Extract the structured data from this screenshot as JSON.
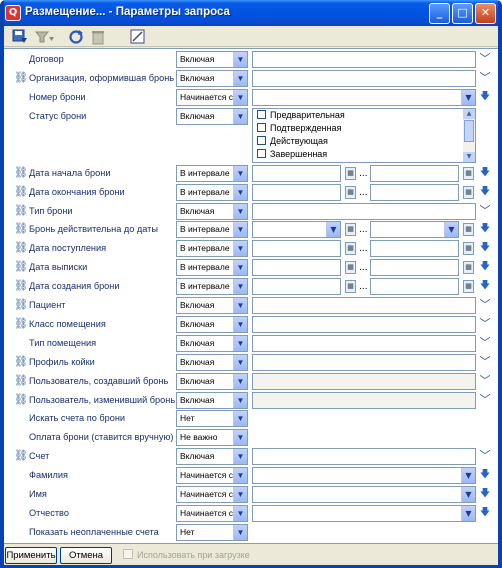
{
  "window": {
    "title": "Размещение... - Параметры запроса",
    "icon": "app-icon",
    "minimize": "_",
    "maximize": "□",
    "close": "✕"
  },
  "toolbar": {
    "icons": [
      "save-filter-icon",
      "clear-filter-icon",
      "refresh-icon",
      "delete-icon",
      "layout-icon"
    ]
  },
  "glyphs": {
    "dropdown": "▼",
    "chevron": "﹀",
    "arrow_down": "🡇",
    "link": "⛓",
    "calendar": "▦",
    "ellipsis": "..."
  },
  "rows": [
    {
      "label": "Договор",
      "op": "Включая",
      "kind": "text",
      "link": false,
      "action": "chevron"
    },
    {
      "label": "Организация, оформившая бронь",
      "op": "Включая",
      "kind": "text",
      "link": true,
      "action": "chevron"
    },
    {
      "label": "Номер брони",
      "op": "Начинается с",
      "kind": "combo",
      "link": false,
      "action": "arrow"
    },
    {
      "label": "Статус брони",
      "op": "Включая",
      "kind": "list",
      "link": false,
      "action": "none",
      "options": [
        "Предварительная",
        "Подтвержденная",
        "Действующая",
        "Завершенная"
      ]
    },
    {
      "label": "Дата начала брони",
      "op": "В интервале",
      "kind": "range",
      "link": true,
      "action": "arrow"
    },
    {
      "label": "Дата окончания брони",
      "op": "В интервале",
      "kind": "range",
      "link": true,
      "action": "arrow"
    },
    {
      "label": "Тип брони",
      "op": "Включая",
      "kind": "text",
      "link": true,
      "action": "chevron"
    },
    {
      "label": "Бронь действительна до даты",
      "op": "В интервале",
      "kind": "range-combo",
      "link": true,
      "action": "arrow"
    },
    {
      "label": "Дата поступления",
      "op": "В интервале",
      "kind": "range",
      "link": true,
      "action": "arrow"
    },
    {
      "label": "Дата выписки",
      "op": "В интервале",
      "kind": "range",
      "link": true,
      "action": "arrow"
    },
    {
      "label": "Дата создания брони",
      "op": "В интервале",
      "kind": "range",
      "link": true,
      "action": "arrow"
    },
    {
      "label": "Пациент",
      "op": "Включая",
      "kind": "text",
      "link": true,
      "action": "chevron"
    },
    {
      "label": "Класс помещения",
      "op": "Включая",
      "kind": "text",
      "link": true,
      "action": "chevron"
    },
    {
      "label": "Тип помещения",
      "op": "Включая",
      "kind": "text",
      "link": false,
      "action": "chevron"
    },
    {
      "label": "Профиль койки",
      "op": "Включая",
      "kind": "text",
      "link": true,
      "action": "chevron"
    },
    {
      "label": "Пользователь, создавший бронь",
      "op": "Включая",
      "kind": "text-dis",
      "link": true,
      "action": "chevron"
    },
    {
      "label": "Пользователь, изменивший бронь",
      "op": "Включая",
      "kind": "text-dis",
      "link": true,
      "action": "chevron"
    },
    {
      "label": "Искать счета по брони",
      "op": "Нет",
      "kind": "none",
      "link": false,
      "action": "none"
    },
    {
      "label": "Оплата брони (ставится вручную)",
      "op": "Не важно",
      "kind": "none",
      "link": false,
      "action": "none"
    },
    {
      "label": "Счет",
      "op": "Включая",
      "kind": "text",
      "link": true,
      "action": "chevron"
    },
    {
      "label": "Фамилия",
      "op": "Начинается с",
      "kind": "combo",
      "link": false,
      "action": "arrow"
    },
    {
      "label": "Имя",
      "op": "Начинается с",
      "kind": "combo",
      "link": false,
      "action": "arrow"
    },
    {
      "label": "Отчество",
      "op": "Начинается с",
      "kind": "combo",
      "link": false,
      "action": "arrow"
    },
    {
      "label": "Показать неоплаченные счета",
      "op": "Нет",
      "kind": "none",
      "link": false,
      "action": "none"
    }
  ],
  "footer": {
    "apply": "Применить",
    "cancel": "Отмена",
    "use_on_load": "Использовать при загрузке",
    "use_on_load_checked": false
  }
}
